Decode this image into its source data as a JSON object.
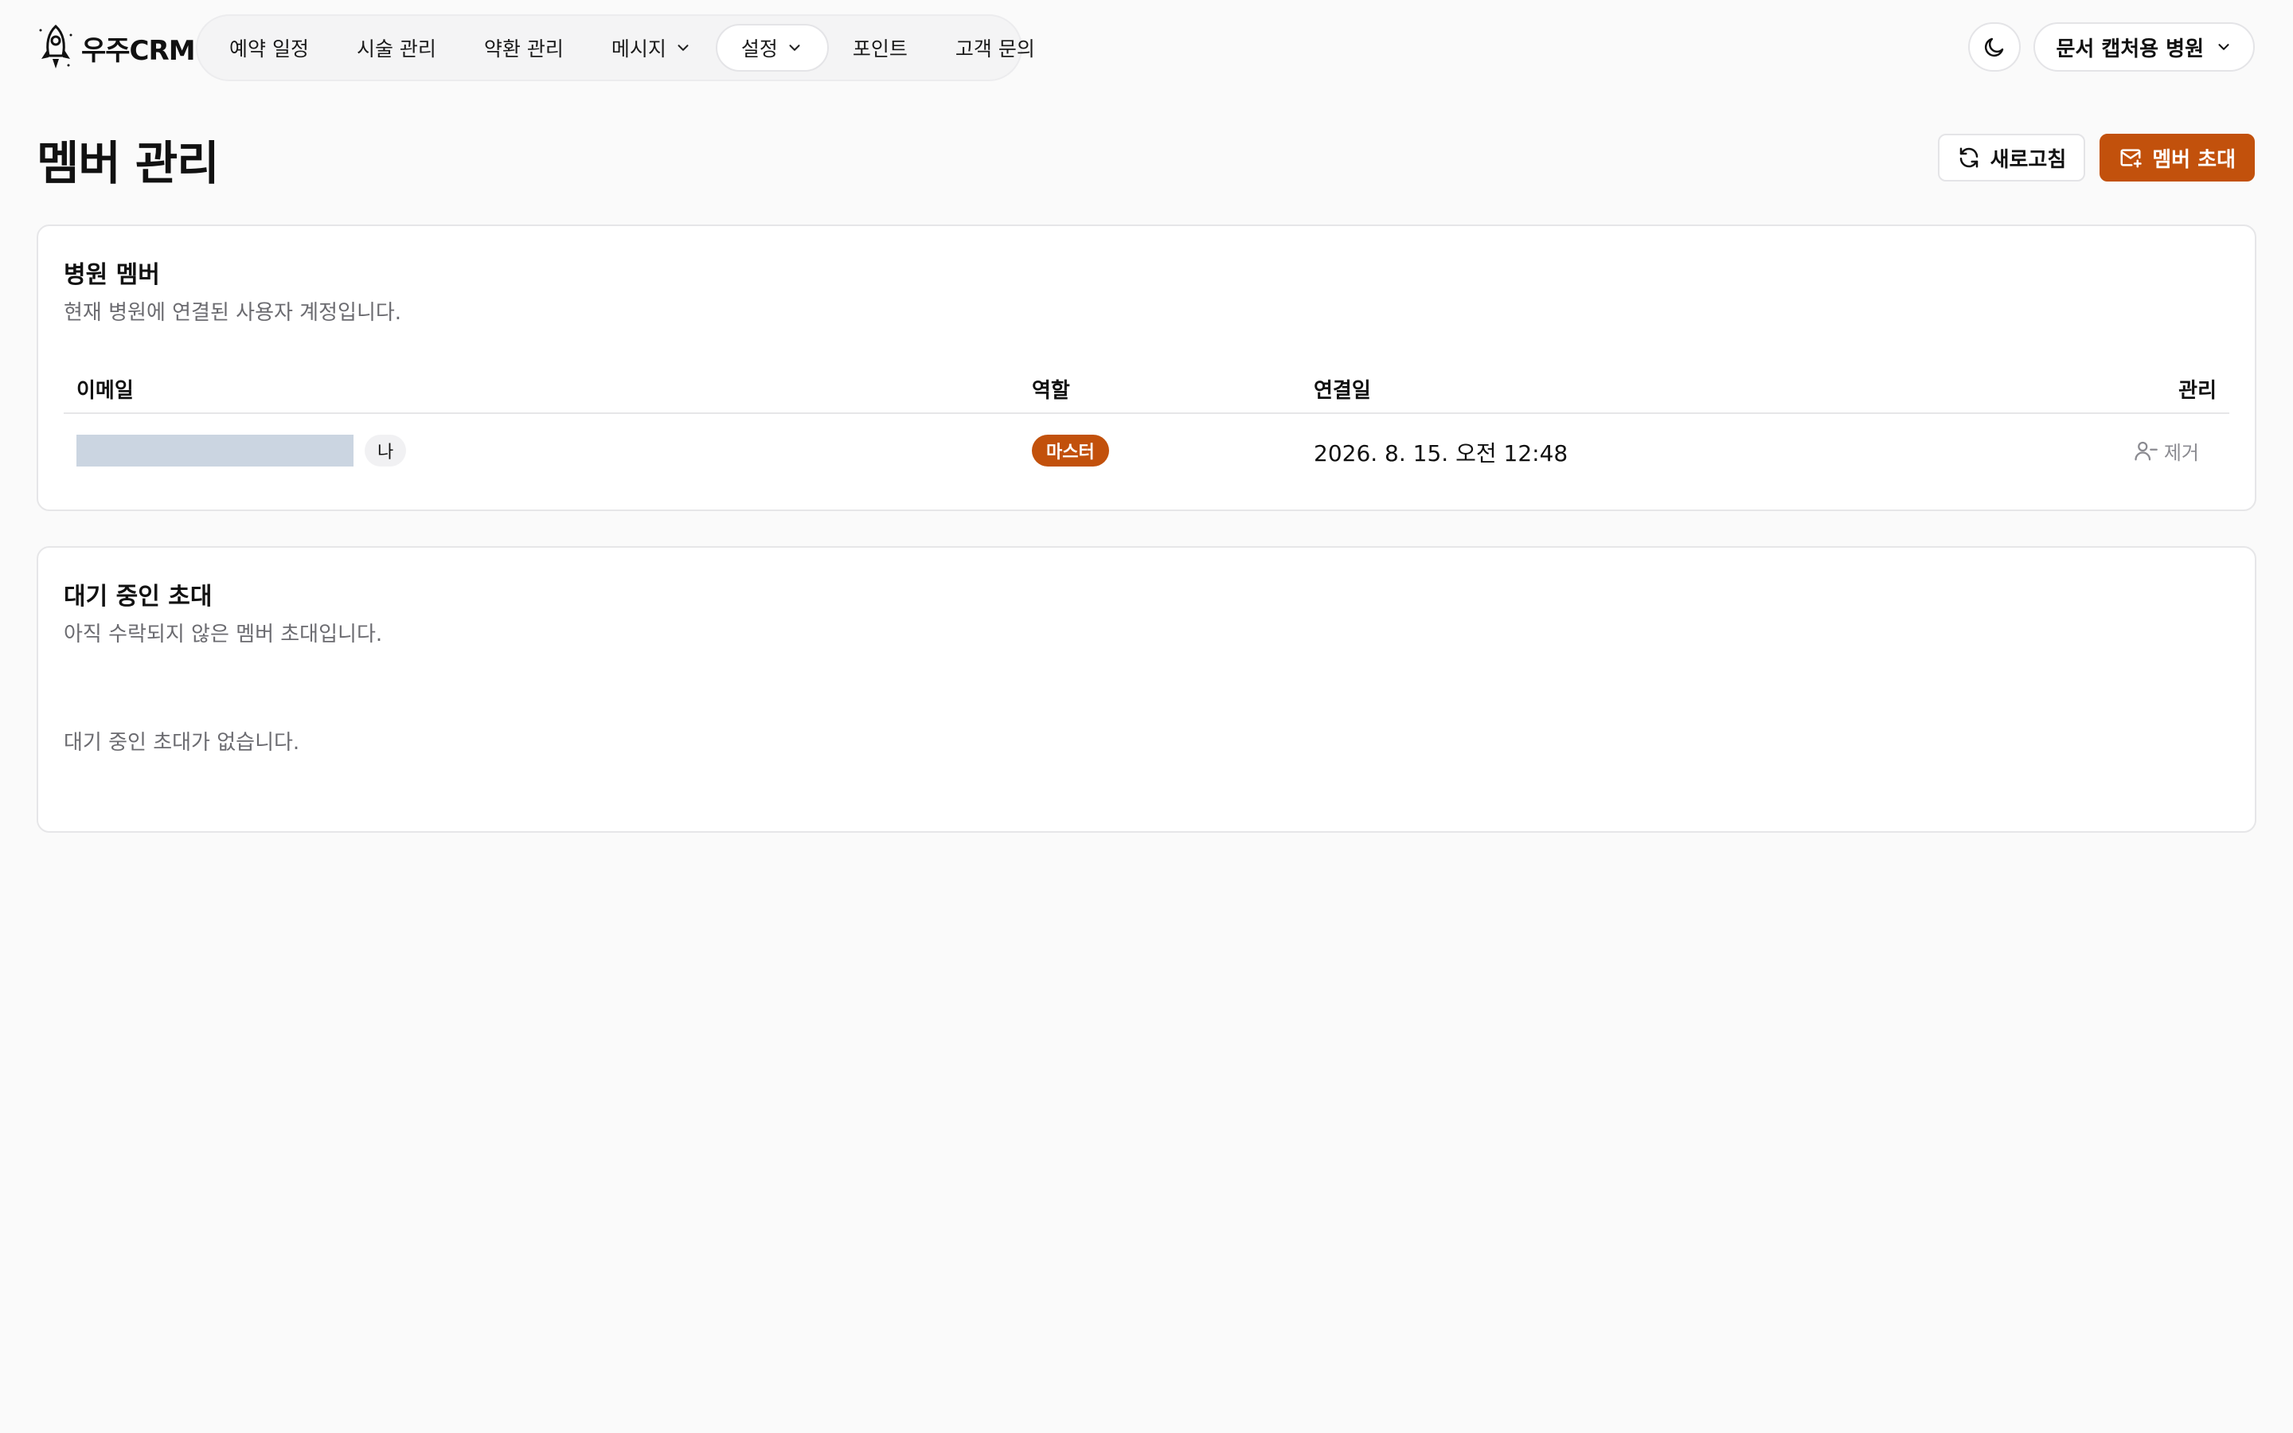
{
  "app": {
    "logo_text": "우주CRM"
  },
  "nav": {
    "items": [
      {
        "label": "예약 일정",
        "has_dropdown": false,
        "active": false
      },
      {
        "label": "시술 관리",
        "has_dropdown": false,
        "active": false
      },
      {
        "label": "약환 관리",
        "has_dropdown": false,
        "active": false
      },
      {
        "label": "메시지",
        "has_dropdown": true,
        "active": false
      },
      {
        "label": "설정",
        "has_dropdown": true,
        "active": true
      },
      {
        "label": "포인트",
        "has_dropdown": false,
        "active": false
      },
      {
        "label": "고객 문의",
        "has_dropdown": false,
        "active": false
      }
    ]
  },
  "header": {
    "theme_icon": "moon-icon",
    "hospital_selector": "문서 캡처용 병원"
  },
  "page": {
    "title": "멤버 관리",
    "refresh_label": "새로고침",
    "invite_label": "멤버 초대"
  },
  "members_card": {
    "title": "병원 멤버",
    "description": "현재 병원에 연결된 사용자 계정입니다.",
    "columns": {
      "email": "이메일",
      "role": "역할",
      "joined": "연결일",
      "manage": "관리"
    },
    "rows": [
      {
        "me_badge": "나",
        "role": "마스터",
        "joined": "2026. 8. 15. 오전 12:48",
        "remove_label": "제거"
      }
    ]
  },
  "invites_card": {
    "title": "대기 중인 초대",
    "description": "아직 수락되지 않은 멤버 초대입니다.",
    "empty_text": "대기 중인 초대가 없습니다."
  },
  "colors": {
    "accent": "#c2510c",
    "background": "#fafafa",
    "masked_email": "#cbd5e1"
  }
}
